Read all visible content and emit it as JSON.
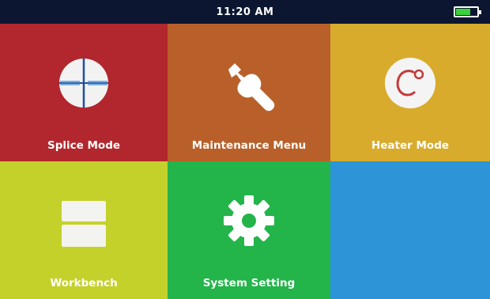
{
  "status_bar": {
    "time": "11:20 AM",
    "battery_level": 0.7,
    "battery_color": "#3bd13b"
  },
  "tiles": [
    {
      "label": "Splice Mode",
      "color": "#b2262d",
      "icon": "crosshair-splice-icon"
    },
    {
      "label": "Maintenance Menu",
      "color": "#b9602a",
      "icon": "wrench-icon"
    },
    {
      "label": "Heater Mode",
      "color": "#d8ab2c",
      "icon": "celsius-icon"
    },
    {
      "label": "Workbench",
      "color": "#c5d12b",
      "icon": "workbench-panels-icon"
    },
    {
      "label": "System Setting",
      "color": "#23b44a",
      "icon": "gear-icon"
    },
    {
      "label": "",
      "color": "#2c94d7",
      "icon": ""
    }
  ]
}
